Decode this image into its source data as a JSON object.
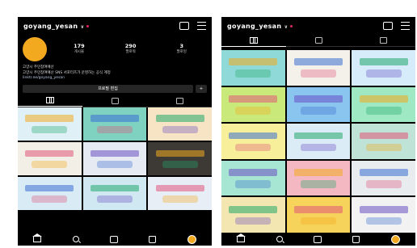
{
  "left": {
    "username": "goyang_yesan",
    "stats": [
      {
        "num": "179",
        "label": "게시물"
      },
      {
        "num": "290",
        "label": "팔로워"
      },
      {
        "num": "3",
        "label": "팔로잉"
      }
    ],
    "bio": [
      "고양시 주민참여예산",
      "고양시 주민참여예산 SNS 서포터즈가 운영하는 공식 계정",
      "linktr.ee/goyang_yesan"
    ],
    "edit_label": "프로필 편집",
    "tiles": [
      "#dff0f7",
      "#7fd1c0",
      "#f6e4c4",
      "#f2f0e6",
      "#e6eaf2",
      "#3d3a36",
      "#d9ecf6",
      "#d0e8f2",
      "#e8eef6"
    ]
  },
  "right": {
    "username": "goyang_yesan",
    "tiles": [
      "#8fdad8",
      "#f4f1eb",
      "#d6ecfb",
      "#c9ea7a",
      "#8ac5f0",
      "#9ee8c4",
      "#f7ef9a",
      "#dcecf6",
      "#bfe3d6",
      "#a6e6d2",
      "#f3b8c2",
      "#e9ecef",
      "#f4e6b0",
      "#f6d35a",
      "#f2f2f2"
    ]
  },
  "colors": {
    "accent": "#f3a91f",
    "notif": "#e0245e"
  }
}
